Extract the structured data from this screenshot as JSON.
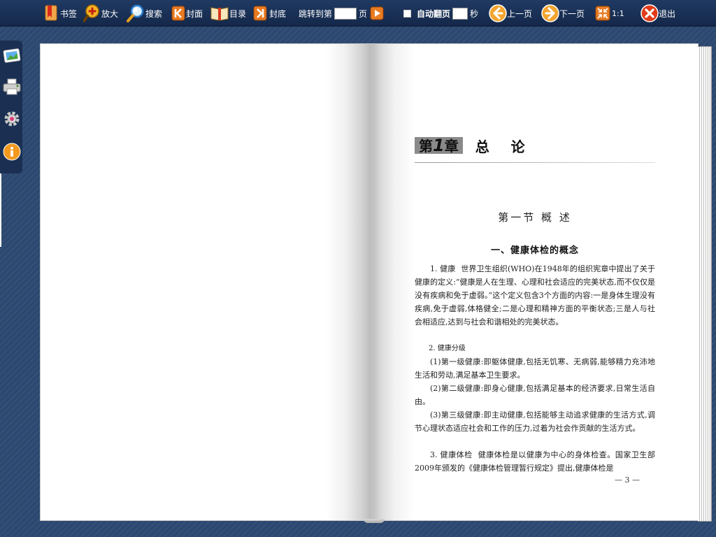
{
  "toolbar": {
    "bookmark": "书签",
    "zoom": "放大",
    "search": "搜索",
    "cover": "封面",
    "toc": "目录",
    "back_cover": "封底",
    "jump_prefix": "跳转到第",
    "jump_suffix": "页",
    "auto_flip": "自动翻页",
    "seconds": "秒",
    "prev": "上一页",
    "next": "下一页",
    "ratio": "1:1",
    "exit": "退出"
  },
  "colors": {
    "toolbar_bg": "#1b3157",
    "icon_orange": "#f0a030",
    "icon_red": "#d93a1a",
    "background": "#2c4870"
  },
  "page": {
    "chapter_prefix": "第",
    "chapter_num": "1",
    "chapter_suffix": "章",
    "chapter_title": "总 论",
    "section_title": "第一节  概  述",
    "subheading": "一、健康体检的概念",
    "paragraphs": [
      {
        "label": "1. 健康",
        "text": "世界卫生组织(WHO)在1948年的组织宪章中提出了关于健康的定义:“健康是人在生理、心理和社会适应的完美状态,而不仅仅是没有疾病和免于虚弱。”这个定义包含3个方面的内容:一是身体生理没有疾病,免于虚弱,体格健全;二是心理和精神方面的平衡状态;三是人与社会相适应,达到与社会和谐相处的完美状态。"
      },
      {
        "label": "2. 健康分级",
        "text": ""
      },
      {
        "label": "",
        "text": "(1)第一级健康:即躯体健康,包括无饥寒、无病弱,能够精力充沛地生活和劳动,满足基本卫生要求。"
      },
      {
        "label": "",
        "text": "(2)第二级健康:即身心健康,包括满足基本的经济要求,日常生活自由。"
      },
      {
        "label": "",
        "text": "(3)第三级健康:即主动健康,包括能够主动追求健康的生活方式,调节心理状态适应社会和工作的压力,过着为社会作贡献的生活方式。"
      },
      {
        "label": "3. 健康体检",
        "text": "健康体检是以健康为中心的身体检查。国家卫生部2009年颁发的《健康体检管理暂行规定》提出,健康体检是"
      }
    ],
    "page_number": "— 3 —"
  }
}
